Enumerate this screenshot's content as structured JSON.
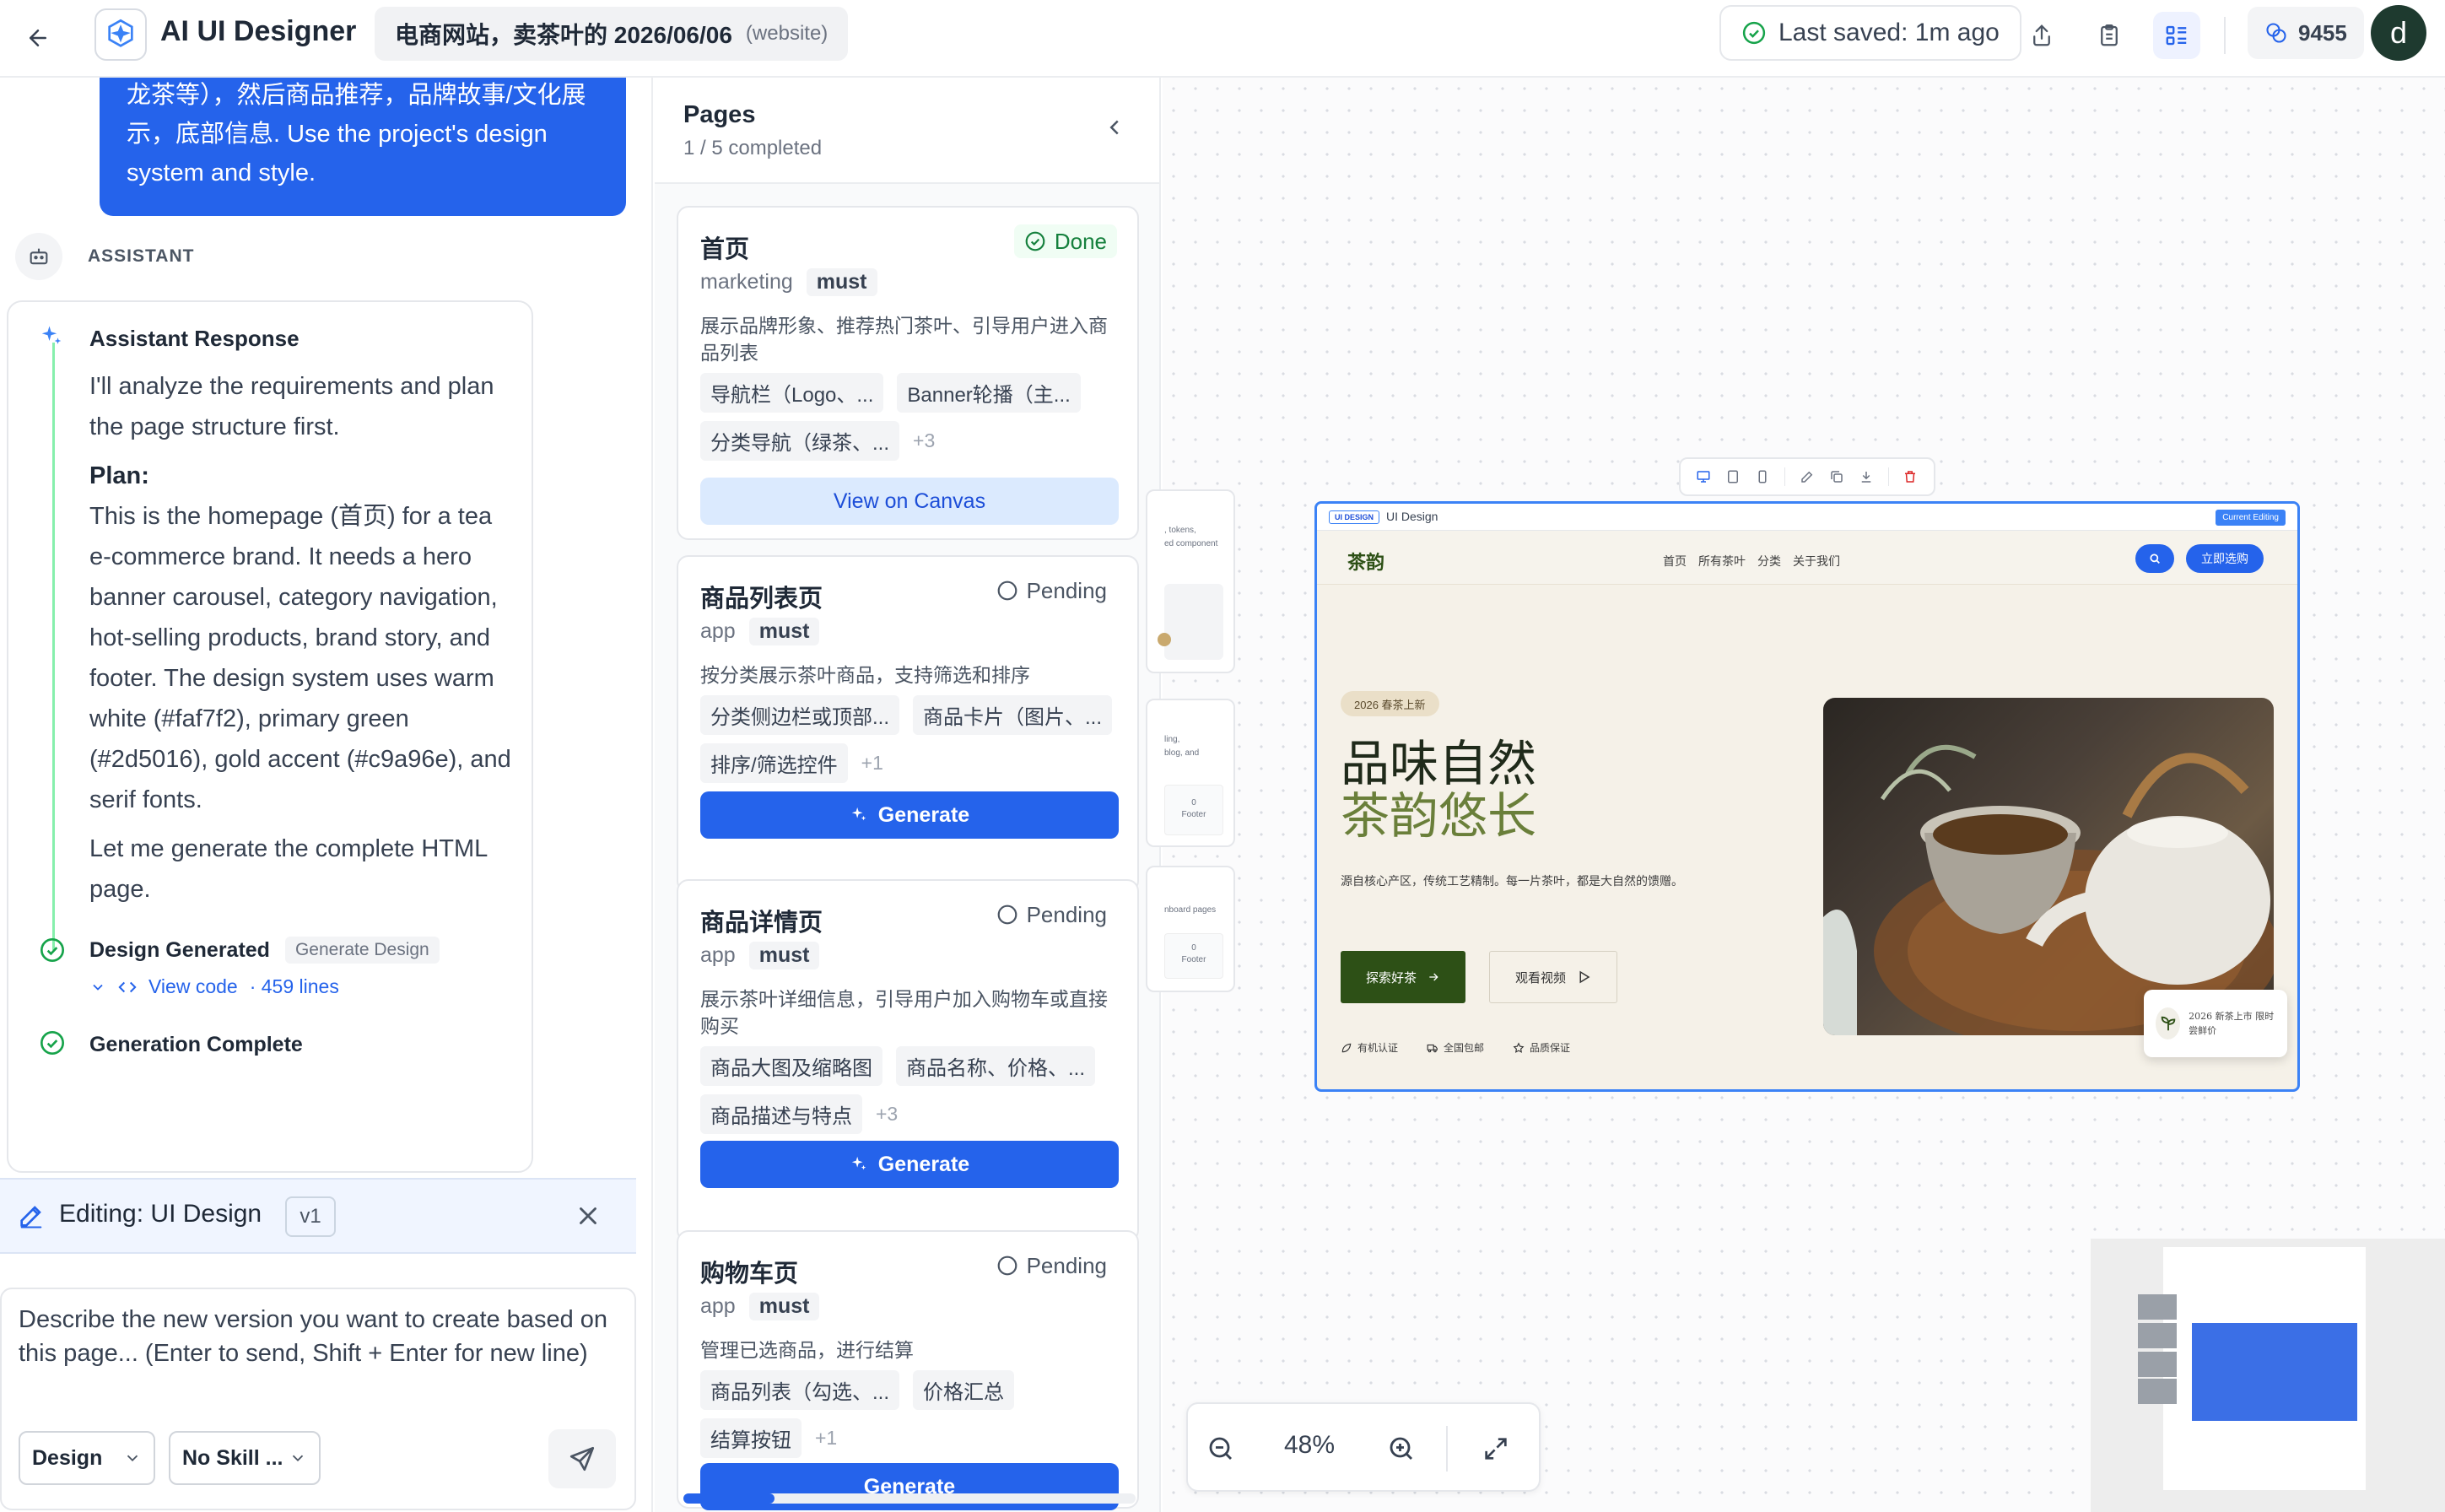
{
  "topbar": {
    "app_title": "AI UI Designer",
    "project_name": "电商网站，卖茶叶的 2026/06/06",
    "project_type": "(website)",
    "saved_status": "Last saved: 1m ago",
    "credits": "9455",
    "avatar_letter": "d"
  },
  "chat": {
    "user_message": "龙茶等），然后商品推荐，品牌故事/文化展示，底部信息. Use the project's design system and style.",
    "assistant_label": "ASSISTANT",
    "response_title": "Assistant Response",
    "intro": "I'll analyze the requirements and plan the page structure first.",
    "plan_heading": "Plan:",
    "plan_body": "This is the homepage (首页) for a tea e-commerce brand. It needs a hero banner carousel, category navigation, hot-selling products, brand story, and footer. The design system uses warm white (#faf7f2), primary green (#2d5016), gold accent (#c9a96e), and serif fonts.",
    "closing": "Let me generate the complete HTML page.",
    "step_generated": "Design Generated",
    "step_generated_tag": "Generate Design",
    "view_code": "View code",
    "lines": "· 459 lines",
    "step_complete": "Generation Complete",
    "editing_label": "Editing: UI Design",
    "version": "v1",
    "composer_placeholder": "Describe the new version you want to create based on this page... (Enter to send, Shift + Enter for new line)",
    "mode_select": "Design",
    "skill_select": "No Skill ..."
  },
  "pages": {
    "title": "Pages",
    "progress": "1 / 5 completed",
    "items": [
      {
        "name": "首页",
        "status": "Done",
        "category": "marketing",
        "priority": "must",
        "description": "展示品牌形象、推荐热门茶叶、引导用户进入商品列表",
        "chips": [
          "导航栏（Logo、...",
          "Banner轮播（主...",
          "分类导航（绿茶、..."
        ],
        "more": "+3",
        "action": "View on Canvas"
      },
      {
        "name": "商品列表页",
        "status": "Pending",
        "category": "app",
        "priority": "must",
        "description": "按分类展示茶叶商品，支持筛选和排序",
        "chips": [
          "分类侧边栏或顶部...",
          "商品卡片（图片、...",
          "排序/筛选控件"
        ],
        "more": "+1",
        "action": "Generate"
      },
      {
        "name": "商品详情页",
        "status": "Pending",
        "category": "app",
        "priority": "must",
        "description": "展示茶叶详细信息，引导用户加入购物车或直接购买",
        "chips": [
          "商品大图及缩略图",
          "商品名称、价格、...",
          "商品描述与特点"
        ],
        "more": "+3",
        "action": "Generate"
      },
      {
        "name": "购物车页",
        "status": "Pending",
        "category": "app",
        "priority": "must",
        "description": "管理已选商品，进行结算",
        "chips": [
          "商品列表（勾选、...",
          "价格汇总",
          "结算按钮"
        ],
        "more": "+1",
        "action": "Generate"
      }
    ]
  },
  "canvas": {
    "ghost_texts": [
      ", tokens,",
      "ed component",
      "ling,",
      "blog, and",
      "Footer",
      "nboard pages",
      "Footer"
    ],
    "ghost_zero": "0",
    "frame_badge": "UI DESIGN",
    "frame_name": "UI Design",
    "current_editing": "Current Editing",
    "site": {
      "logo": "茶韵",
      "nav": [
        "首页",
        "所有茶叶",
        "分类",
        "关于我们"
      ],
      "cta": "立即选购",
      "hero_tag": "2026 春茶上新",
      "headline_1": "品味自然",
      "headline_2": "茶韵悠长",
      "hero_text": "源自核心产区，传统工艺精制。每一片茶叶，都是大自然的馈赠。",
      "primary_btn": "探索好茶",
      "secondary_btn": "观看视频",
      "badges": [
        "有机认证",
        "全国包邮",
        "品质保证"
      ],
      "float_card": "2026 新茶上市 限时尝鲜价"
    },
    "zoom": "48%"
  },
  "colors": {
    "accent": "#2563eb",
    "success": "#16a34a",
    "brand_green": "#2d5016"
  }
}
